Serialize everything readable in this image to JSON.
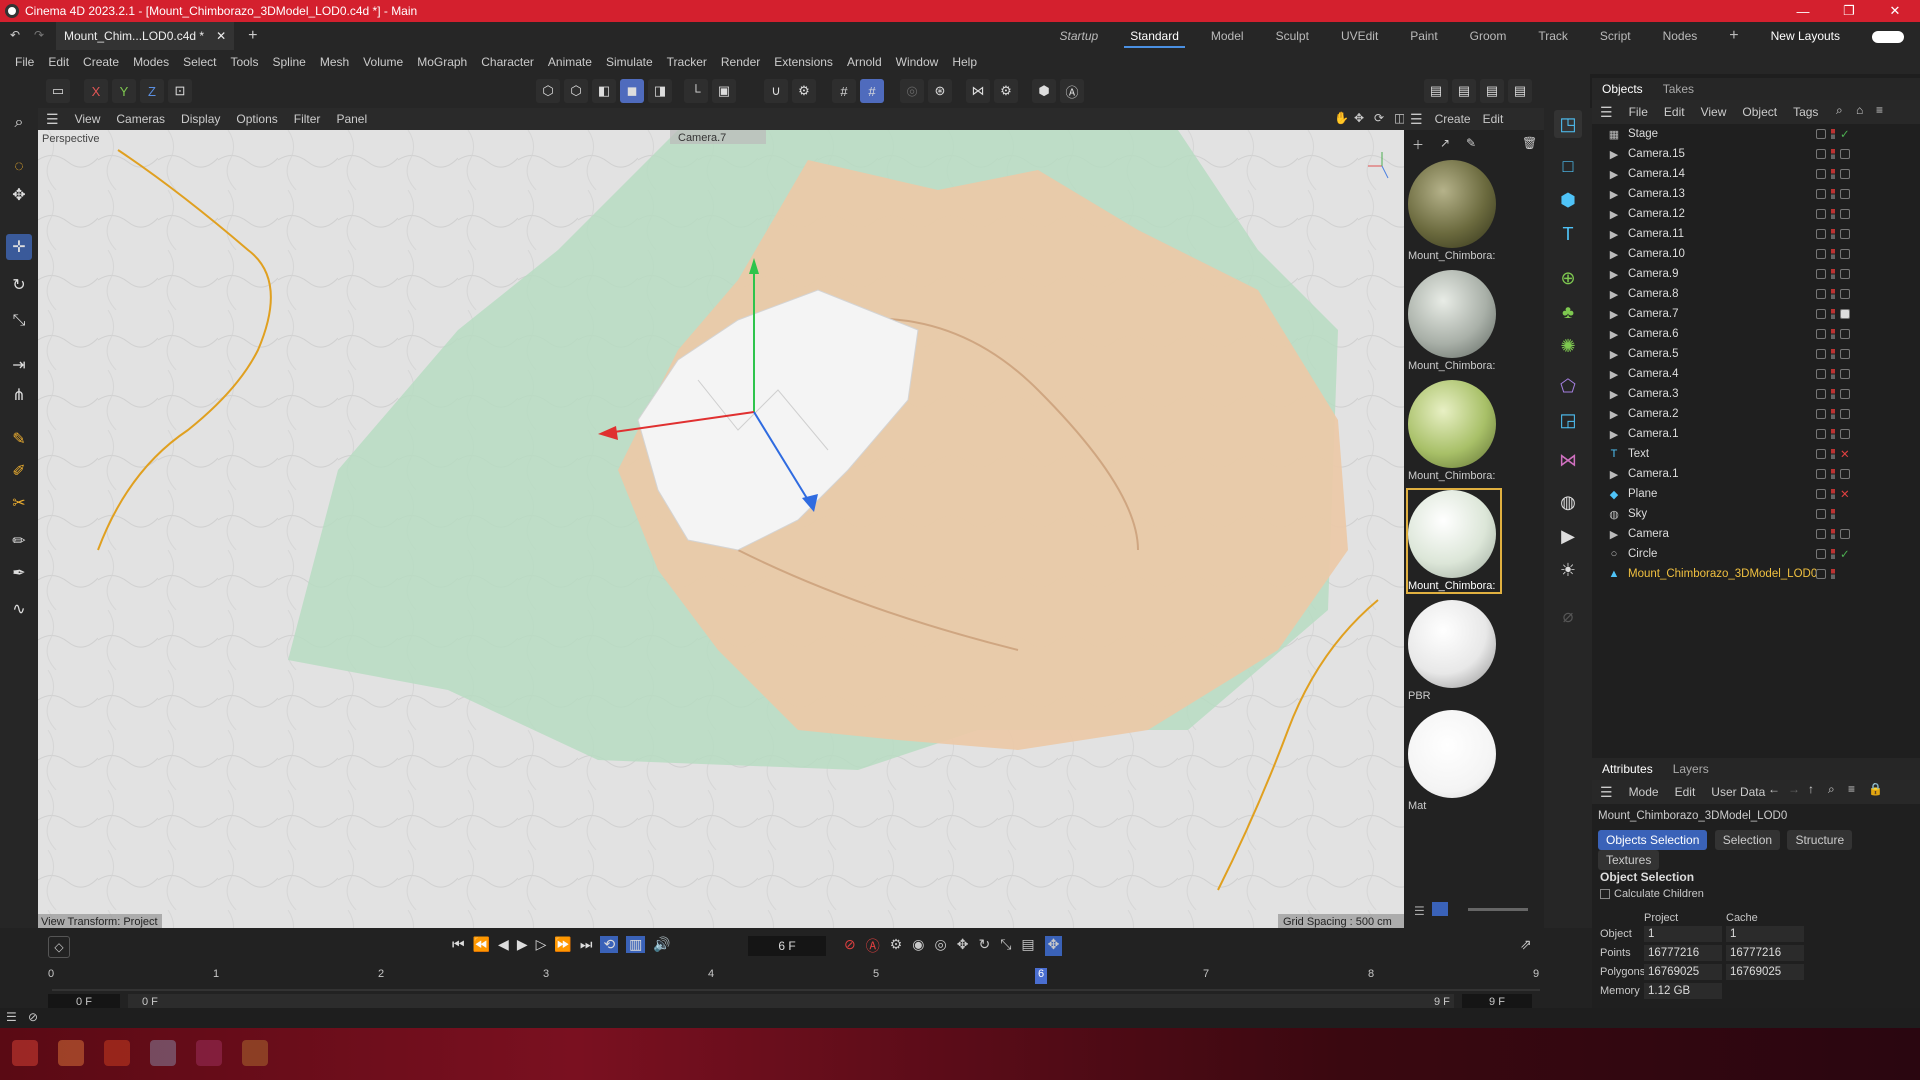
{
  "window": {
    "title": "Cinema 4D 2023.2.1 - [Mount_Chimborazo_3DModel_LOD0.c4d *] - Main"
  },
  "doc_tab": {
    "label": "Mount_Chim...LOD0.c4d *"
  },
  "layouts": {
    "items": [
      "Startup",
      "Standard",
      "Model",
      "Sculpt",
      "UVEdit",
      "Paint",
      "Groom",
      "Track",
      "Script",
      "Nodes"
    ],
    "active": "Standard",
    "new_layouts": "New Layouts"
  },
  "menu": [
    "File",
    "Edit",
    "Create",
    "Modes",
    "Select",
    "Tools",
    "Spline",
    "Mesh",
    "Volume",
    "MoGraph",
    "Character",
    "Animate",
    "Simulate",
    "Tracker",
    "Render",
    "Extensions",
    "Arnold",
    "Window",
    "Help"
  ],
  "axis_buttons": [
    "X",
    "Y",
    "Z"
  ],
  "viewport": {
    "menu": [
      "View",
      "Cameras",
      "Display",
      "Options",
      "Filter",
      "Panel"
    ],
    "label": "Perspective",
    "camera": "Camera.7",
    "view_transform": "View Transform: Project",
    "grid_spacing": "Grid Spacing : 500 cm"
  },
  "material_panel": {
    "menu": [
      "Create",
      "Edit"
    ],
    "materials": [
      {
        "name": "Mount_Chimbora:",
        "color": "#6b6a3e"
      },
      {
        "name": "Mount_Chimbora:",
        "color": "#a9b0a8"
      },
      {
        "name": "Mount_Chimbora:",
        "color": "#a8c068"
      },
      {
        "name": "Mount_Chimbora:",
        "color": "#dce6d8",
        "selected": true
      },
      {
        "name": "PBR",
        "color": "#e8e8e8"
      },
      {
        "name": "Mat",
        "color": "#ffffff"
      }
    ]
  },
  "objects_panel": {
    "tabs": [
      "Objects",
      "Takes"
    ],
    "menu": [
      "File",
      "Edit",
      "View",
      "Object",
      "Tags"
    ],
    "objects": [
      {
        "name": "Stage",
        "icon": "stage-icon"
      },
      {
        "name": "Camera.15",
        "icon": "camera-icon"
      },
      {
        "name": "Camera.14",
        "icon": "camera-icon"
      },
      {
        "name": "Camera.13",
        "icon": "camera-icon"
      },
      {
        "name": "Camera.12",
        "icon": "camera-icon"
      },
      {
        "name": "Camera.11",
        "icon": "camera-icon"
      },
      {
        "name": "Camera.10",
        "icon": "camera-icon"
      },
      {
        "name": "Camera.9",
        "icon": "camera-icon"
      },
      {
        "name": "Camera.8",
        "icon": "camera-icon"
      },
      {
        "name": "Camera.7",
        "icon": "camera-icon"
      },
      {
        "name": "Camera.6",
        "icon": "camera-icon"
      },
      {
        "name": "Camera.5",
        "icon": "camera-icon"
      },
      {
        "name": "Camera.4",
        "icon": "camera-icon"
      },
      {
        "name": "Camera.3",
        "icon": "camera-icon"
      },
      {
        "name": "Camera.2",
        "icon": "camera-icon"
      },
      {
        "name": "Camera.1",
        "icon": "camera-icon"
      },
      {
        "name": "Text",
        "icon": "text-icon"
      },
      {
        "name": "Camera.1",
        "icon": "camera-icon"
      },
      {
        "name": "Plane",
        "icon": "plane-icon"
      },
      {
        "name": "Sky",
        "icon": "sky-icon"
      },
      {
        "name": "Camera",
        "icon": "camera-icon"
      },
      {
        "name": "Circle",
        "icon": "circle-icon"
      },
      {
        "name": "Mount_Chimborazo_3DModel_LOD0",
        "icon": "polygon-icon",
        "selected": true
      }
    ]
  },
  "attributes_panel": {
    "tabs": [
      "Attributes",
      "Layers"
    ],
    "menu": [
      "Mode",
      "Edit",
      "User Data"
    ],
    "object_name": "Mount_Chimborazo_3DModel_LOD0",
    "buttons": [
      "Objects Selection",
      "Selection",
      "Structure",
      "Textures"
    ],
    "section": "Object Selection",
    "calculate_children": "Calculate Children",
    "col_project": "Project",
    "col_cache": "Cache",
    "rows": [
      {
        "label": "Object",
        "project": "1",
        "cache": "1"
      },
      {
        "label": "Points",
        "project": "16777216",
        "cache": "16777216"
      },
      {
        "label": "Polygons",
        "project": "16769025",
        "cache": "16769025"
      },
      {
        "label": "Memory",
        "project": "1.12 GB",
        "cache": ""
      }
    ]
  },
  "timeline": {
    "current_frame": "6 F",
    "ticks": [
      "0",
      "1",
      "2",
      "3",
      "4",
      "5",
      "6",
      "7",
      "8",
      "9"
    ],
    "start": "0 F",
    "range_start": "0 F",
    "range_end": "9 F",
    "end": "9 F"
  },
  "colors": {
    "accent": "#4a90e2",
    "titlebar": "#d4202e"
  }
}
